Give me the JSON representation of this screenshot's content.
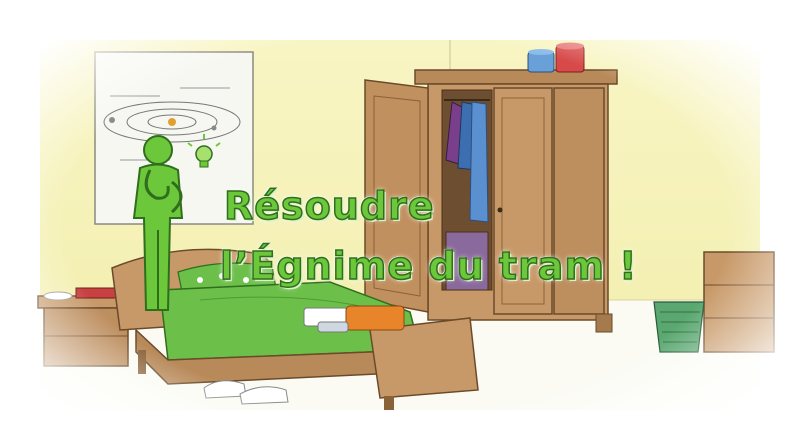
{
  "title": {
    "line1": "Résoudre",
    "line2": "l’Égnime du tram !"
  },
  "colors": {
    "accent_green": "#6cc83a",
    "wall": "#f6f2b8",
    "wood": "#b88a5a",
    "bedspread": "#6cc04a"
  },
  "icons": {
    "character": "thinking-person-icon",
    "idea": "lightbulb-icon"
  }
}
